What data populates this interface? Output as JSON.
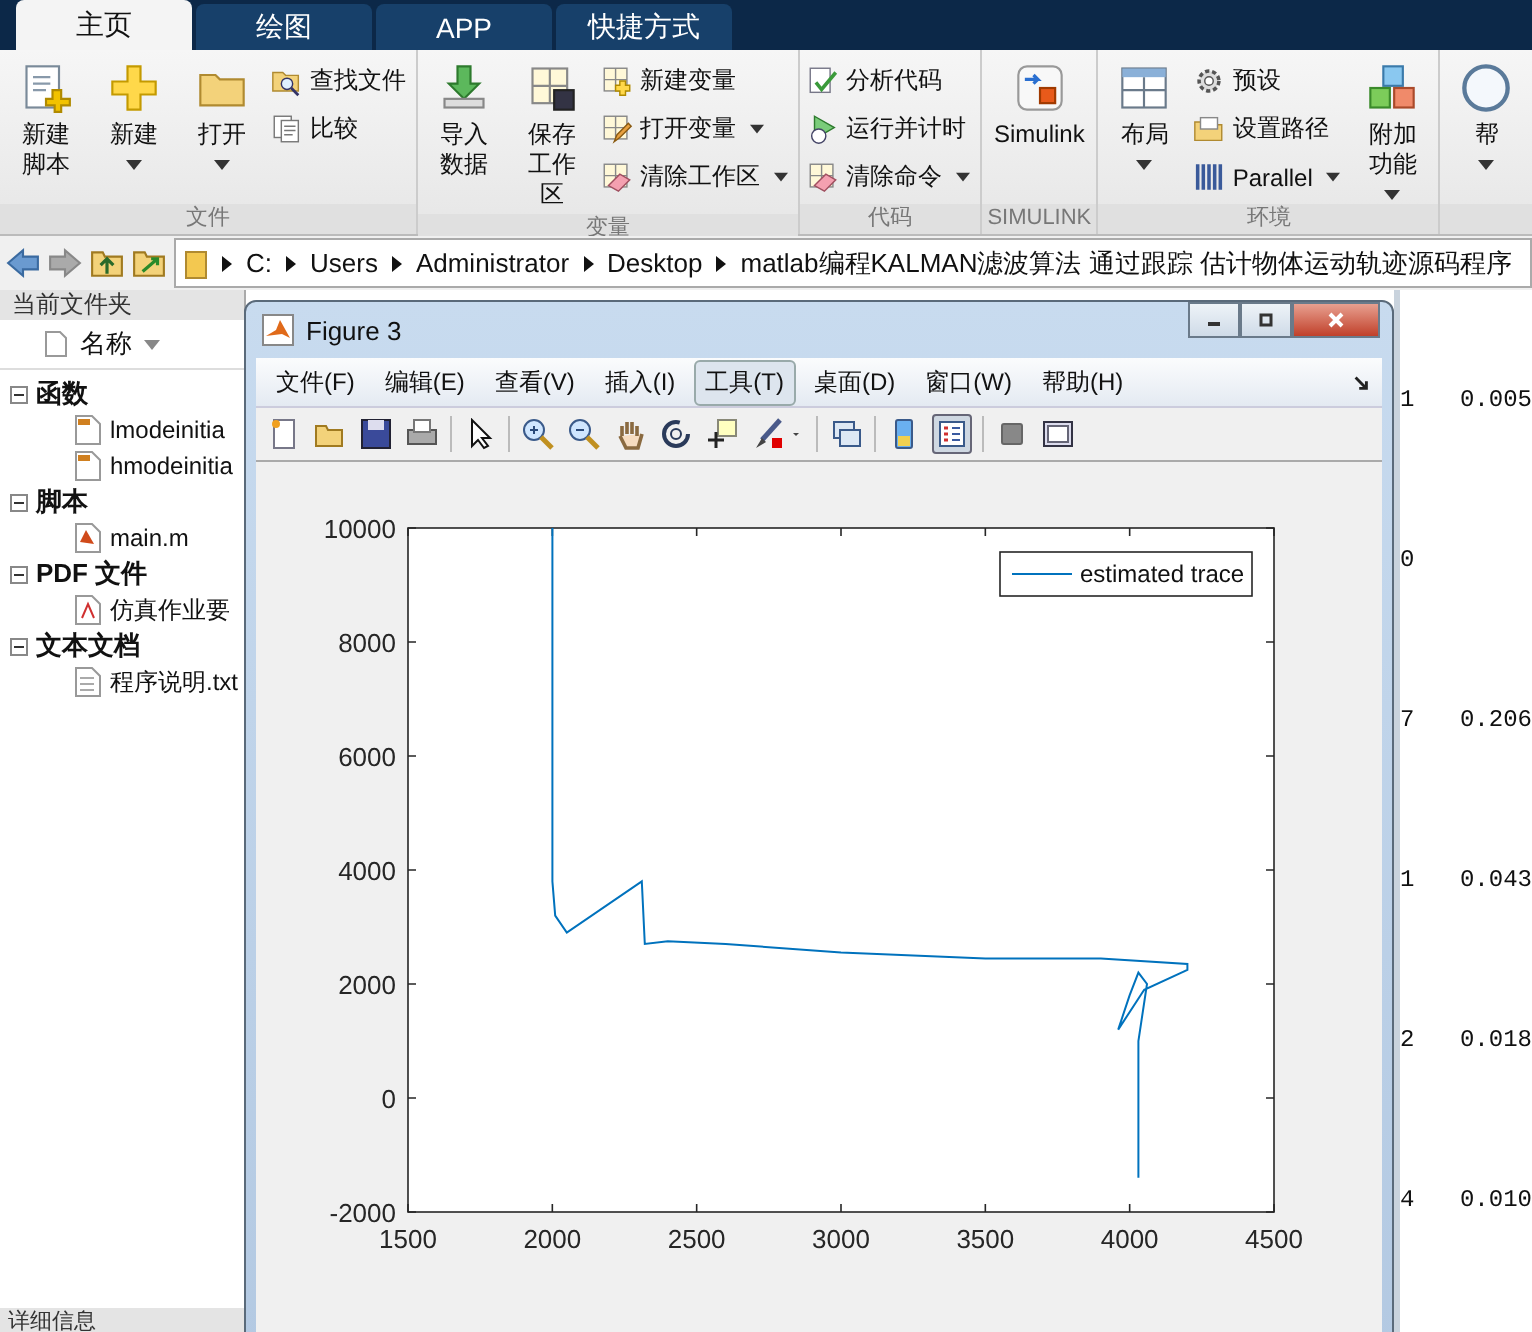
{
  "tabs": [
    {
      "label": "主页",
      "selected": true
    },
    {
      "label": "绘图",
      "selected": false
    },
    {
      "label": "APP",
      "selected": false
    },
    {
      "label": "快捷方式",
      "selected": false
    }
  ],
  "ribbon": [
    {
      "label": "文件",
      "items": [
        {
          "kind": "big_two_line",
          "label": "新建脚本",
          "dropdown": false
        },
        {
          "kind": "big",
          "label": "新建",
          "dropdown": true
        },
        {
          "kind": "big",
          "label": "打开",
          "dropdown": true
        },
        {
          "kind": "stack",
          "entries": [
            {
              "label": "查找文件",
              "dropdown": false
            },
            {
              "label": "比较",
              "dropdown": false
            }
          ]
        }
      ]
    },
    {
      "label": "变量",
      "items": [
        {
          "kind": "big_two_line",
          "label": "导入数据",
          "dropdown": false
        },
        {
          "kind": "big_two_line",
          "label": "保存工作区",
          "dropdown": false
        },
        {
          "kind": "stack",
          "entries": [
            {
              "label": "新建变量",
              "dropdown": false
            },
            {
              "label": "打开变量",
              "dropdown": true
            },
            {
              "label": "清除工作区",
              "dropdown": true
            }
          ]
        }
      ]
    },
    {
      "label": "代码",
      "items": [
        {
          "kind": "stack",
          "entries": [
            {
              "label": "分析代码",
              "dropdown": false
            },
            {
              "label": "运行并计时",
              "dropdown": false
            },
            {
              "label": "清除命令",
              "dropdown": true
            }
          ]
        }
      ]
    },
    {
      "label": "SIMULINK",
      "items": [
        {
          "kind": "big",
          "label": "Simulink",
          "dropdown": false
        }
      ]
    },
    {
      "label": "环境",
      "items": [
        {
          "kind": "big",
          "label": "布局",
          "dropdown": true
        },
        {
          "kind": "stack",
          "entries": [
            {
              "label": "预设",
              "dropdown": false
            },
            {
              "label": "设置路径",
              "dropdown": false
            },
            {
              "label": "Parallel",
              "dropdown": true
            }
          ]
        },
        {
          "kind": "big",
          "label": "附加功能",
          "dropdown": true
        }
      ]
    },
    {
      "items": [
        {
          "kind": "big",
          "label": "帮",
          "dropdown": true
        }
      ]
    }
  ],
  "path": [
    "C:",
    "Users",
    "Administrator",
    "Desktop",
    "matlab编程KALMAN滤波算法 通过跟踪 估计物体运动轨迹源码程序"
  ],
  "file_panel": {
    "title": "当前文件夹",
    "column": "名称",
    "tree": [
      {
        "label": "函数",
        "expanded": true,
        "children": [
          {
            "label": "lmodeinitia"
          },
          {
            "label": "hmodeinitia"
          }
        ]
      },
      {
        "label": "脚本",
        "expanded": true,
        "children": [
          {
            "label": "main.m"
          }
        ]
      },
      {
        "label": "PDF 文件",
        "expanded": true,
        "children": [
          {
            "label": "仿真作业要"
          }
        ]
      },
      {
        "label": "文本文档",
        "expanded": true,
        "children": [
          {
            "label": "程序说明.txt"
          }
        ]
      }
    ],
    "details": "详细信息"
  },
  "command_window": {
    "rows": [
      {
        "column_1": "1",
        "column_2": "0.005"
      },
      {
        "column_1": "0",
        "column_2": ""
      },
      {
        "column_1": "7",
        "column_2": "0.206"
      },
      {
        "column_1": "1",
        "column_2": "0.043"
      },
      {
        "column_1": "2",
        "column_2": "0.018"
      },
      {
        "column_1": "4",
        "column_2": "0.010"
      }
    ]
  },
  "figure": {
    "title": "Figure 3",
    "menus": [
      {
        "label": "文件(F)",
        "selected": false
      },
      {
        "label": "编辑(E)",
        "selected": false
      },
      {
        "label": "查看(V)",
        "selected": false
      },
      {
        "label": "插入(I)",
        "selected": false
      },
      {
        "label": "工具(T)",
        "selected": true
      },
      {
        "label": "桌面(D)",
        "selected": false
      },
      {
        "label": "窗口(W)",
        "selected": false
      },
      {
        "label": "帮助(H)",
        "selected": false
      }
    ],
    "legend_button_on": true,
    "chart_data": {
      "type": "line",
      "xlim": [
        1500,
        4500
      ],
      "ylim": [
        -2000,
        10000
      ],
      "xticks": [
        1500,
        2000,
        2500,
        3000,
        3500,
        4000,
        4500
      ],
      "yticks": [
        -2000,
        0,
        2000,
        4000,
        6000,
        8000,
        10000
      ],
      "x": [
        2000,
        2000,
        2010,
        2050,
        2310,
        2320,
        2400,
        2600,
        3000,
        3500,
        3900,
        4200,
        4200,
        4050,
        3960,
        4000,
        4030,
        4060,
        4030,
        4030
      ],
      "series": [
        {
          "name": "estimated trace",
          "color": "#0072bd",
          "values": [
            10000,
            3800,
            3200,
            2900,
            3800,
            2700,
            2750,
            2700,
            2550,
            2450,
            2450,
            2350,
            2250,
            1900,
            1200,
            1800,
            2200,
            2000,
            1000,
            -1400
          ]
        }
      ]
    }
  }
}
